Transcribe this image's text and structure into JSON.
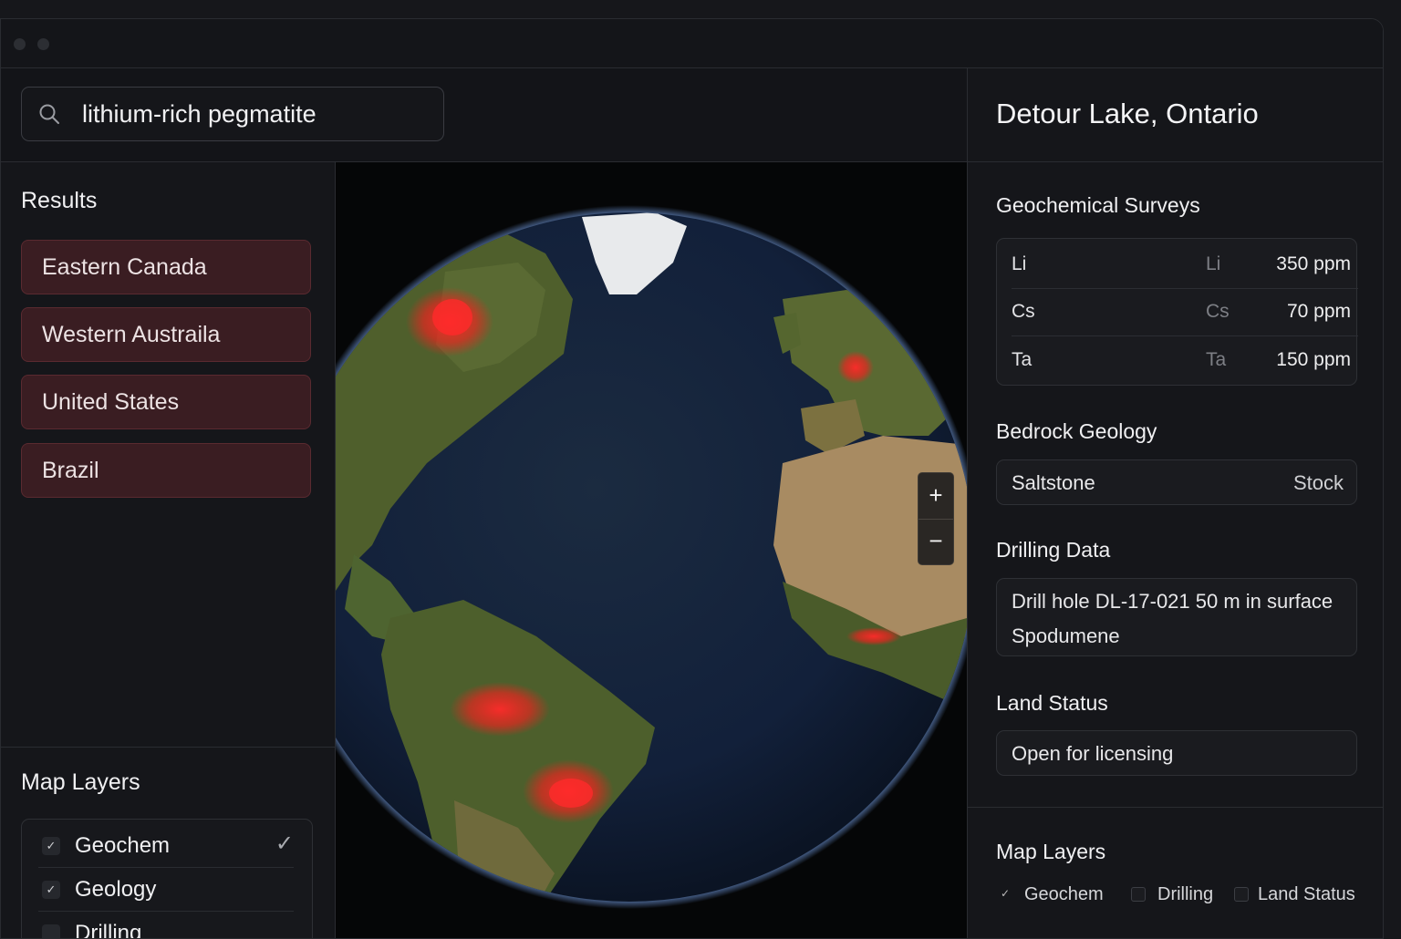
{
  "search": {
    "query": "lithium-rich pegmatite"
  },
  "results": {
    "title": "Results",
    "items": [
      "Eastern Canada",
      "Western Austraila",
      "United States",
      "Brazil"
    ]
  },
  "left_layers": {
    "title": "Map Layers",
    "items": [
      {
        "label": "Geochem",
        "checked": true
      },
      {
        "label": "Geology",
        "checked": true
      },
      {
        "label": "Drilling",
        "checked": false
      }
    ]
  },
  "map": {
    "zoom_in": "+",
    "zoom_out": "−"
  },
  "details": {
    "location": "Detour Lake, Ontario",
    "geochem": {
      "title": "Geochemical Surveys",
      "rows": [
        {
          "element": "Li",
          "symbol": "Li",
          "value": "350 ppm"
        },
        {
          "element": "Cs",
          "symbol": "Cs",
          "value": "70 ppm"
        },
        {
          "element": "Ta",
          "symbol": "Ta",
          "value": "150 ppm"
        }
      ]
    },
    "bedrock": {
      "title": "Bedrock Geology",
      "rock": "Saltstone",
      "type": "Stock"
    },
    "drilling": {
      "title": "Drilling Data",
      "line1": "Drill hole DL-17-021 50 m in surface",
      "line2": "Spodumene"
    },
    "land": {
      "title": "Land Status",
      "status": "Open for licensing"
    }
  },
  "right_layers": {
    "title": "Map Layers",
    "items": [
      {
        "label": "Geochem",
        "checked": true
      },
      {
        "label": "Drilling",
        "checked": false
      },
      {
        "label": "Land Status",
        "checked": false
      }
    ]
  },
  "colors": {
    "accent_hotspot": "#ff2020",
    "result_bg": "#3a1d22",
    "ocean": "#142134"
  }
}
